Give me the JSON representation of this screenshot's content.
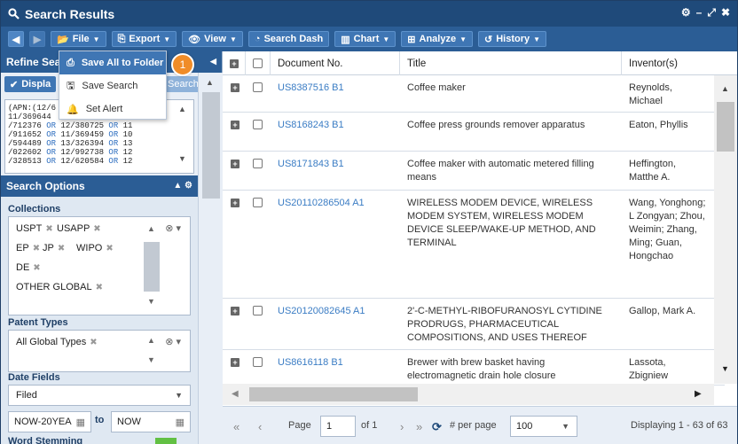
{
  "window": {
    "title": "Search Results"
  },
  "toolbar": {
    "file": "File",
    "export": "Export",
    "view": "View",
    "search_dash": "Search Dash",
    "chart": "Chart",
    "analyze": "Analyze",
    "history": "History"
  },
  "left_panel": {
    "refine_title": "Refine Sea",
    "display_btn": "Displa",
    "search_btn": "Search",
    "query_lines": [
      "(APN:(12/6",
      "11/369644",
      "/712376 OR 12/380725 OR 11",
      "/911652 OR 11/369459 OR 10",
      "/594489 OR 13/326394 OR 13",
      "/022602 OR 12/992738 OR 12",
      "/328513 OR 12/620584 OR 12"
    ]
  },
  "search_options": {
    "title": "Search Options",
    "collections_label": "Collections",
    "collections": [
      "USPT",
      "USAPP",
      "EP",
      "JP",
      "WIPO",
      "DE",
      "OTHER GLOBAL"
    ],
    "patent_types_label": "Patent Types",
    "patent_types": [
      "All Global Types"
    ],
    "date_fields_label": "Date Fields",
    "date_field_value": "Filed",
    "date_from": "NOW-20YEA",
    "date_to_label": "to",
    "date_to": "NOW",
    "word_stemming_label": "Word Stemming"
  },
  "file_menu": {
    "items": [
      "Save All to Folder",
      "Save Search",
      "Set Alert"
    ],
    "step_badge": "1"
  },
  "grid": {
    "columns": [
      "Document No.",
      "Title",
      "Inventor(s)"
    ],
    "rows": [
      {
        "doc": "US8387516 B1",
        "title": "Coffee maker",
        "inventor": "Reynolds, Michael"
      },
      {
        "doc": "US8168243 B1",
        "title": "Coffee press grounds remover apparatus",
        "inventor": "Eaton, Phyllis"
      },
      {
        "doc": "US8171843 B1",
        "title": "Coffee maker with automatic metered filling means",
        "inventor": "Heffington, Matthe A."
      },
      {
        "doc": "US20110286504 A1",
        "title": "WIRELESS MODEM DEVICE, WIRELESS MODEM SYSTEM, WIRELESS MODEM DEVICE SLEEP/WAKE-UP METHOD, AND TERMINAL",
        "inventor": "Wang, Yonghong; L Zongyan; Zhou, Weimin; Zhang, Ming; Guan, Hongchao"
      },
      {
        "doc": "US20120082645 A1",
        "title": "2'-C-METHYL-RIBOFURANOSYL CYTIDINE PRODRUGS, PHARMACEUTICAL COMPOSITIONS, AND USES THEREOF",
        "inventor": "Gallop, Mark A."
      },
      {
        "doc": "US8616118 B1",
        "title": "Brewer with brew basket having electromagnetic drain hole closure",
        "inventor": "Lassota, Zbigniew"
      }
    ]
  },
  "pager": {
    "page_label": "Page",
    "page_value": "1",
    "of_label": "of 1",
    "per_page_label": "# per page",
    "per_page_value": "100",
    "displaying": "Displaying 1 - 63 of 63"
  }
}
